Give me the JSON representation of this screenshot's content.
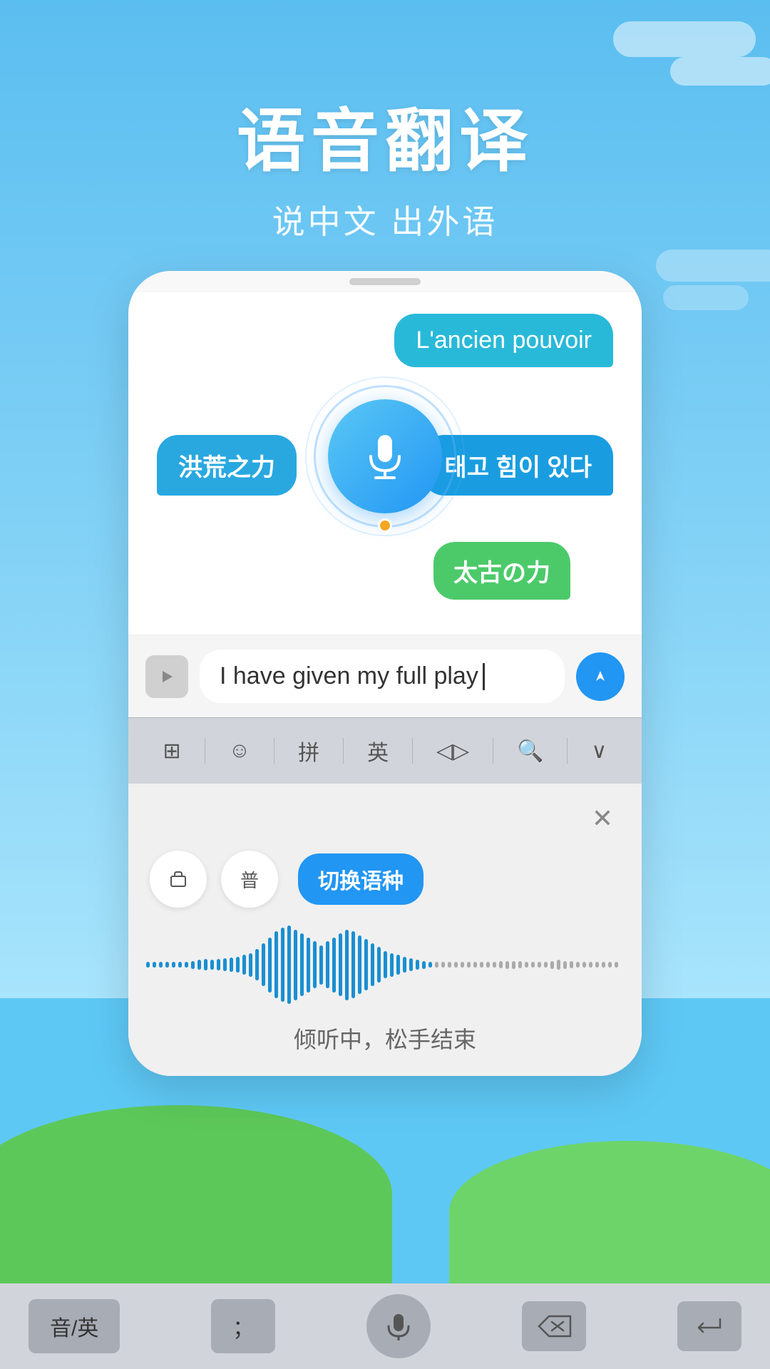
{
  "header": {
    "title": "语音翻译",
    "subtitle": "说中文 出外语"
  },
  "phone": {
    "bubbles": {
      "french": "L'ancien pouvoir",
      "chinese_left": "洪荒之力",
      "korean": "태고 힘이 있다",
      "japanese": "太古の力"
    },
    "input_text": "I have given my full play",
    "voice_options": {
      "btn1_label": "☰",
      "btn2_label": "普",
      "lang_switch_label": "切换语种"
    },
    "voice_hint": "倾听中，松手结束"
  },
  "keyboard_toolbar": {
    "items": [
      "⊞",
      "😊",
      "拼",
      "英",
      "◁▷",
      "🔍",
      "∨"
    ]
  },
  "sys_keyboard": {
    "lang_key": "音/英",
    "comma": "；",
    "backspace_label": "⌫",
    "enter_label": "↵"
  }
}
